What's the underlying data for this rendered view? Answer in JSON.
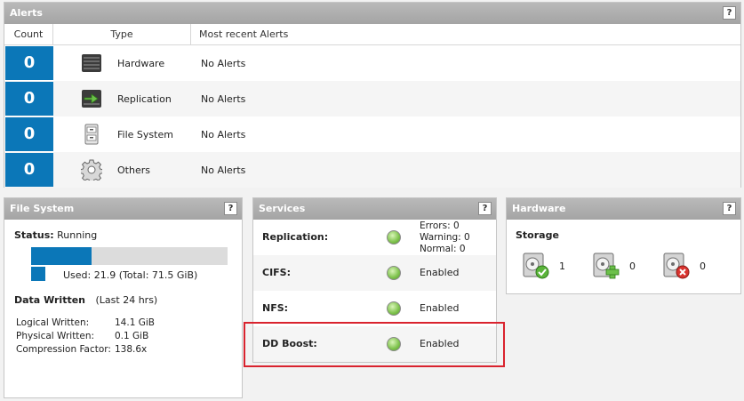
{
  "alerts": {
    "title": "Alerts",
    "help": "?",
    "columns": {
      "count": "Count",
      "type": "Type",
      "recent": "Most recent Alerts"
    },
    "rows": [
      {
        "count": "0",
        "type": "Hardware",
        "recent": "No Alerts",
        "icon": "hardware-icon"
      },
      {
        "count": "0",
        "type": "Replication",
        "recent": "No Alerts",
        "icon": "replication-icon"
      },
      {
        "count": "0",
        "type": "File System",
        "recent": "No Alerts",
        "icon": "file-system-icon"
      },
      {
        "count": "0",
        "type": "Others",
        "recent": "No Alerts",
        "icon": "gear-icon"
      }
    ]
  },
  "filesystem": {
    "title": "File System",
    "help": "?",
    "status_label": "Status:",
    "status_value": "Running",
    "usage_fraction": 0.306,
    "used_text": "Used: 21.9 (Total: 71.5 GiB)",
    "data_written_label": "Data Written",
    "data_written_period": "(Last 24 hrs)",
    "metrics": [
      {
        "label": "Logical Written:",
        "value": "14.1 GiB"
      },
      {
        "label": "Physical Written:",
        "value": "0.1 GiB"
      },
      {
        "label": "Compression Factor:",
        "value": "138.6x"
      }
    ]
  },
  "services": {
    "title": "Services",
    "help": "?",
    "replication": {
      "name": "Replication:",
      "errors": "Errors: 0",
      "warning": "Warning: 0",
      "normal": "Normal: 0"
    },
    "cifs": {
      "name": "CIFS:",
      "status": "Enabled"
    },
    "nfs": {
      "name": "NFS:",
      "status": "Enabled"
    },
    "ddboost": {
      "name": "DD Boost:",
      "status": "Enabled"
    },
    "led_color": "#7cc14a"
  },
  "hardware": {
    "title": "Hardware",
    "help": "?",
    "storage_label": "Storage",
    "items": [
      {
        "icon": "disk-ok-icon",
        "count": "1"
      },
      {
        "icon": "disk-add-icon",
        "count": "0"
      },
      {
        "icon": "disk-failed-icon",
        "count": "0"
      }
    ]
  },
  "colors": {
    "accent": "#0b77b8",
    "highlight": "#d9232e"
  }
}
